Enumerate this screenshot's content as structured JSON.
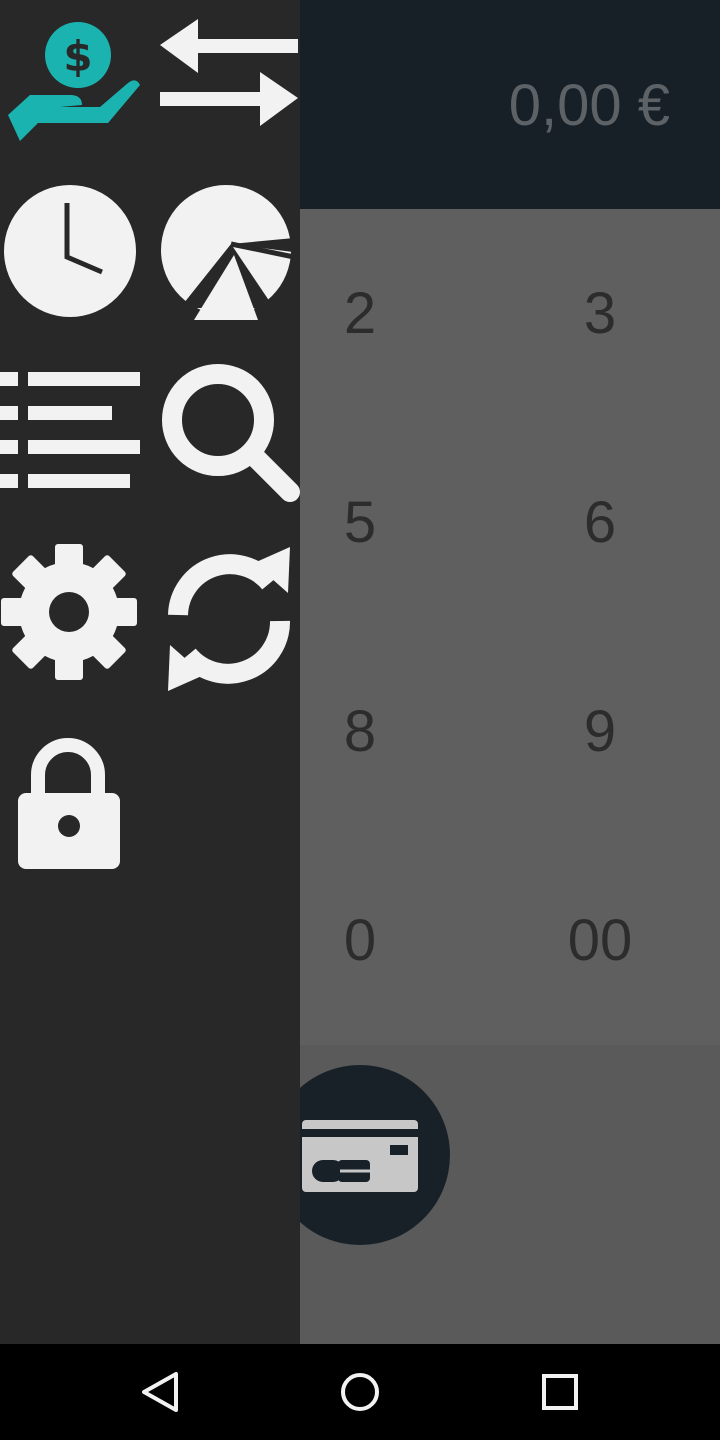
{
  "amount_display": {
    "value": "0,00 €"
  },
  "keypad": {
    "keys": [
      "2",
      "3",
      "5",
      "6",
      "8",
      "9",
      "0",
      "00"
    ]
  },
  "drawer": {
    "icons": [
      "receive-payment-icon",
      "transfer-arrows-icon",
      "clock-icon",
      "pie-chart-icon",
      "list-icon",
      "search-icon",
      "settings-gear-icon",
      "refresh-icon",
      "lock-icon"
    ],
    "colors": {
      "accent": "#1bb3b0",
      "background": "#282828",
      "icon": "#f2f2f2"
    }
  },
  "payment_button": {
    "icon": "credit-card-icon",
    "color": "#182128"
  },
  "navigation": {
    "icons": [
      "back-icon",
      "home-icon",
      "recents-icon"
    ]
  }
}
